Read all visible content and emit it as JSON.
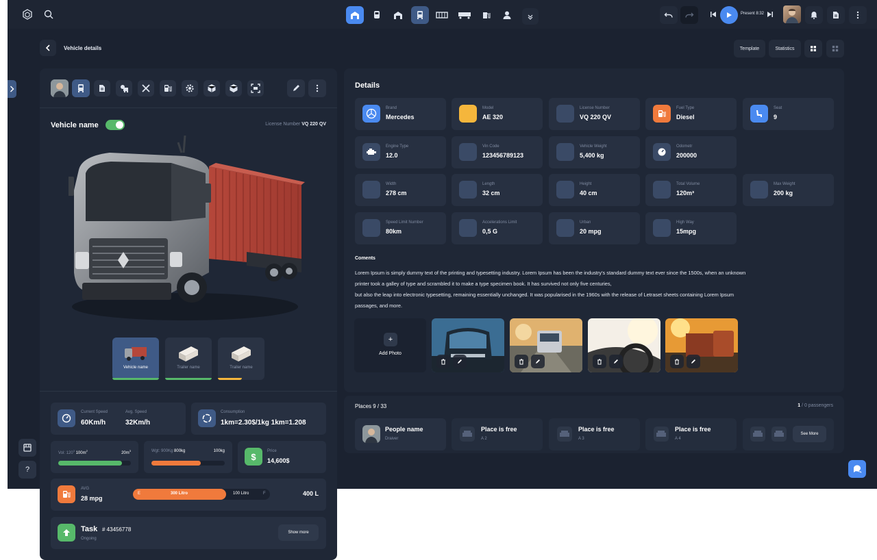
{
  "topbar": {
    "present_label": "Present 8:32"
  },
  "header": {
    "title": "Vehicle details",
    "template_label": "Template",
    "statistics_label": "Statistics"
  },
  "vehicle": {
    "name_label": "Vehicle name",
    "license_label": "License Number",
    "license_value": "VQ 220 QV",
    "thumbs": [
      {
        "label": "Vehicle name"
      },
      {
        "label": "Trailer name"
      },
      {
        "label": "Trailer name"
      }
    ]
  },
  "stats": {
    "current_speed_label": "Current Speed",
    "current_speed_value": "60Km/h",
    "avg_speed_label": "Avg. Speed",
    "avg_speed_value": "32Km/h",
    "consumption_label": "Consumption",
    "consumption_value": "1km=2.30$/1kg 1km=1.208",
    "vol_label": "Vol: 120",
    "vol_sup": "3",
    "vol_value": "100m",
    "vol_value_sup": "2",
    "vol_max": "20m",
    "vol_max_sup": "3",
    "vol_fill": 0.88,
    "wgt_label": "Wgt: 900Kg",
    "wgt_value": "800kg",
    "wgt_max": "100kg",
    "wgt_fill": 0.67,
    "price_label": "Price",
    "price_value": "14,600$",
    "avg_label": "AVG",
    "avg_value": "28 mpg",
    "fuel_e": "E",
    "fuel_bar_label": "300 Litro",
    "fuel_remaining": "100 Litro",
    "fuel_f": "F",
    "fuel_total": "400 L",
    "task_label": "Task",
    "task_number": "# 43456778",
    "task_status": "Ongoing",
    "show_more_label": "Show more"
  },
  "details": {
    "title": "Details",
    "items": [
      {
        "label": "Brand",
        "value": "Mercedes",
        "icon": "mercedes-icon",
        "color": "#4a8af0"
      },
      {
        "label": "Model",
        "value": "AE 320",
        "icon": "model-icon",
        "color": "#f5b63c"
      },
      {
        "label": "License Number",
        "value": "VQ 220 QV",
        "icon": "",
        "color": "#3a4a66"
      },
      {
        "label": "Fuel Type",
        "value": "Diesel",
        "icon": "fuel-pump-icon",
        "color": "#f07a3c"
      },
      {
        "label": "Seat",
        "value": "9",
        "icon": "seat-icon",
        "color": "#4a8af0"
      },
      {
        "label": "Engine Type",
        "value": "12.0",
        "icon": "engine-icon",
        "color": "#3a4a66"
      },
      {
        "label": "Vin Code",
        "value": "123456789123",
        "icon": "",
        "color": "#3a4a66"
      },
      {
        "label": "Vehicle Weight",
        "value": "5,400 kg",
        "icon": "",
        "color": "#3a4a66"
      },
      {
        "label": "Odometr",
        "value": "200000",
        "icon": "odometer-icon",
        "color": "#3a4a66"
      },
      {
        "label": "Width",
        "value": "278 cm",
        "icon": "",
        "color": "#3a4a66"
      },
      {
        "label": "Length",
        "value": "32 cm",
        "icon": "",
        "color": "#3a4a66"
      },
      {
        "label": "Height",
        "value": "40 cm",
        "icon": "",
        "color": "#3a4a66"
      },
      {
        "label": "Total Volume",
        "value": "120m³",
        "icon": "",
        "color": "#3a4a66"
      },
      {
        "label": "Max Weight",
        "value": "200 kg",
        "icon": "",
        "color": "#3a4a66"
      },
      {
        "label": "Speed Limit Number",
        "value": "80km",
        "icon": "",
        "color": "#3a4a66"
      },
      {
        "label": "Accelerations Limit",
        "value": "0,5 G",
        "icon": "",
        "color": "#3a4a66"
      },
      {
        "label": "Urban",
        "value": "20 mpg",
        "icon": "",
        "color": "#3a4a66"
      },
      {
        "label": "High Way",
        "value": "15mpg",
        "icon": "",
        "color": "#3a4a66"
      }
    ]
  },
  "comments": {
    "title": "Coments",
    "lines": [
      "Lorem Ipsum is simply dummy text of the printing and typesetting industry. Lorem Ipsum has been the industry's standard dummy text ever since the 1500s, when an unknown",
      "printer took a galley of type and scrambled it to make a type specimen book. It has survived not only five centuries,",
      "but also the leap into electronic typesetting, remaining essentially unchanged. It was popularised in the 1960s with the release of Letraset sheets containing Lorem Ipsum",
      "passages, and more."
    ],
    "add_photo_label": "Add Photo"
  },
  "places": {
    "title": "Places 9 / 33",
    "passengers_count": "1",
    "passengers_label": "/ 0 passengers",
    "person_name": "People  name",
    "person_role": "Draiver",
    "free_label": "Place is free",
    "seats": [
      "A 2",
      "A 3",
      "A 4"
    ],
    "see_more_label": "See More"
  },
  "colors": {
    "accent": "#4a8af0",
    "green": "#57b96a",
    "orange": "#f07a3c",
    "yellow": "#f5b63c"
  }
}
